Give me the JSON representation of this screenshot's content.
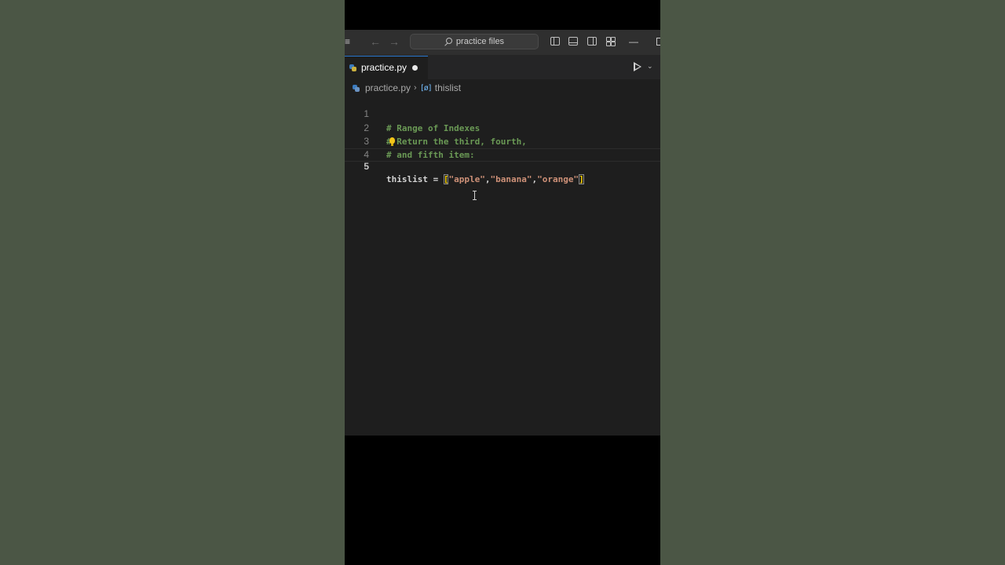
{
  "titlebar": {
    "menu_glyph": "≡",
    "back_glyph": "←",
    "forward_glyph": "→",
    "search_label": "practice files",
    "minimize_glyph": "—"
  },
  "tab": {
    "filename": "practice.py",
    "modified": true
  },
  "breadcrumb": {
    "file": "practice.py",
    "separator": "›",
    "symbol_icon": "[ø]",
    "symbol": "thislist"
  },
  "code": {
    "active_line": 5,
    "lines": [
      {
        "number": "1",
        "text": "# Range of Indexes"
      },
      {
        "number": "2",
        "text": "# Return the third, fourth,"
      },
      {
        "number": "3",
        "text": "# and fifth item:"
      },
      {
        "number": "4",
        "text": ""
      },
      {
        "number": "5",
        "var": "thislist",
        "op": " = ",
        "open": "[",
        "items": [
          "\"apple\"",
          ",",
          "\"banana\"",
          ",",
          "\"orange\""
        ],
        "close": "]"
      }
    ]
  },
  "colors": {
    "page_background": "#4b5645",
    "editor_background": "#1e1e1e",
    "comment": "#6a9955",
    "string": "#ce9178",
    "bracket": "#ffd700",
    "active_tab_border": "#2b7ad1"
  }
}
